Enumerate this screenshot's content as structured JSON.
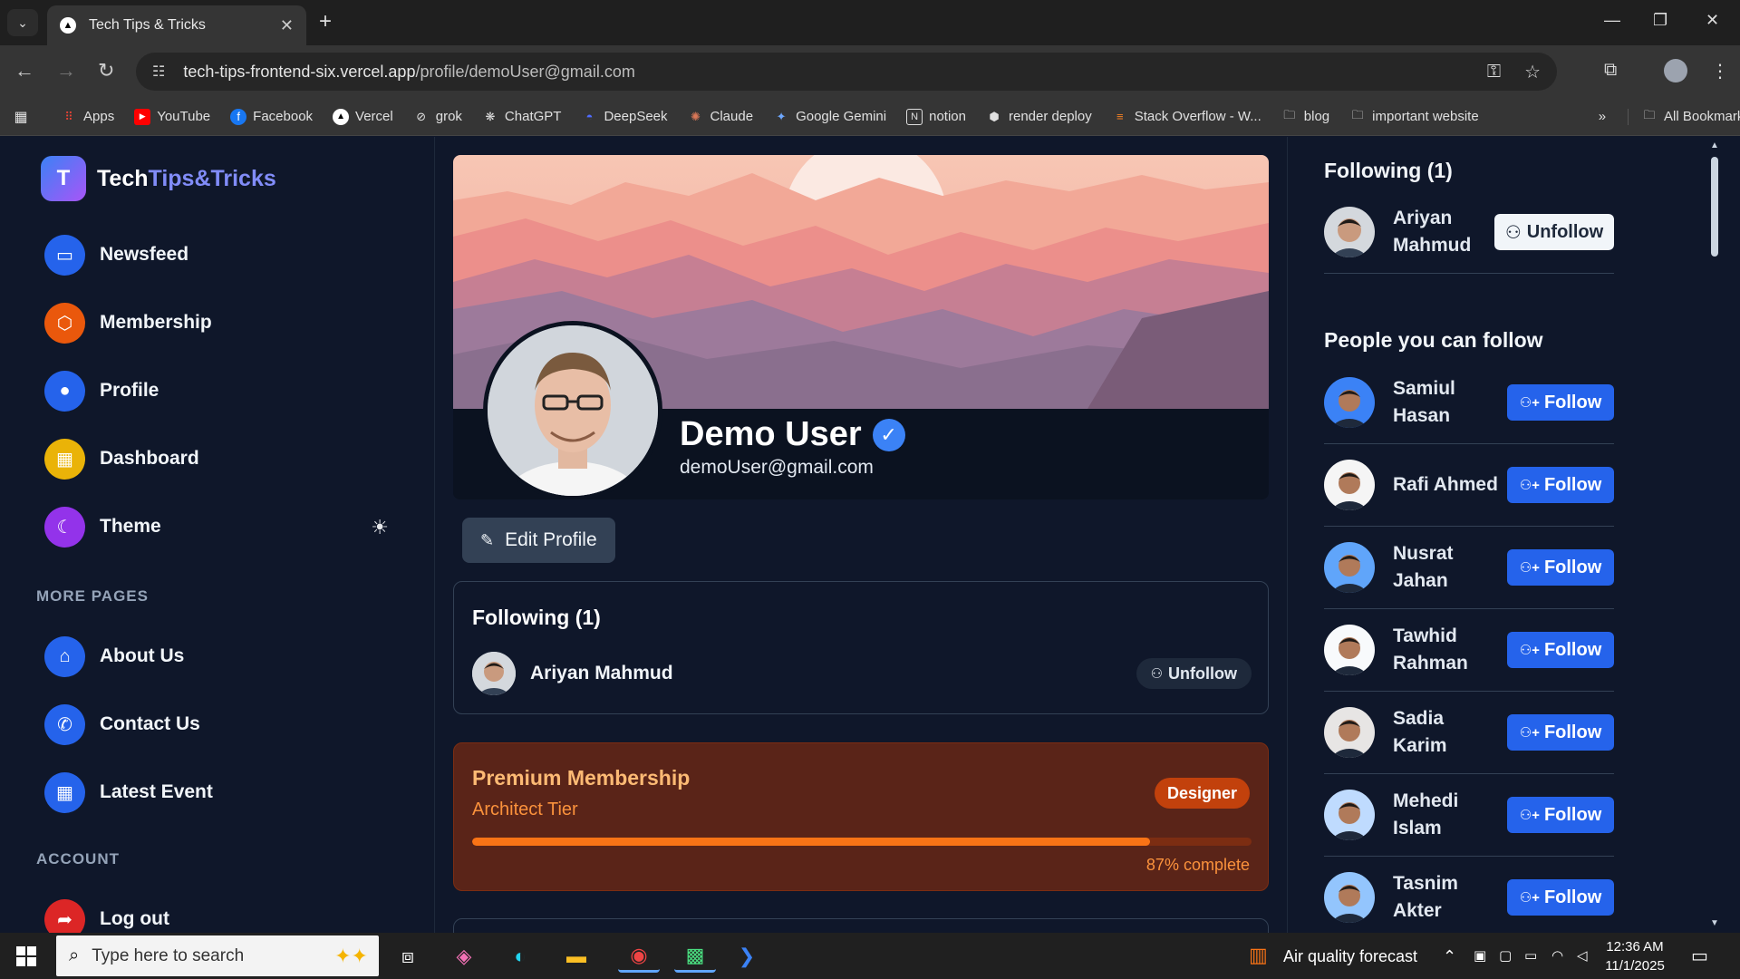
{
  "browser": {
    "tab_title": "Tech Tips & Tricks",
    "url_host": "tech-tips-frontend-six.vercel.app",
    "url_path": "/profile/demoUser@gmail.com",
    "bookmarks": [
      "Apps",
      "YouTube",
      "Facebook",
      "Vercel",
      "grok",
      "ChatGPT",
      "DeepSeek",
      "Claude",
      "Google Gemini",
      "notion",
      "render deploy",
      "Stack Overflow - W...",
      "blog",
      "important website"
    ],
    "all_bookmarks": "All Bookmarks"
  },
  "sidebar": {
    "logo_letter": "T",
    "logo_part1": "Tech",
    "logo_part2": "Tips&Tricks",
    "nav": [
      {
        "label": "Newsfeed",
        "color": "#2563eb",
        "icon": "monitor-icon"
      },
      {
        "label": "Membership",
        "color": "#ea580c",
        "icon": "box-icon"
      },
      {
        "label": "Profile",
        "color": "#2563eb",
        "icon": "user-circle-icon"
      },
      {
        "label": "Dashboard",
        "color": "#eab308",
        "icon": "grid-icon"
      },
      {
        "label": "Theme",
        "color": "#9333ea",
        "icon": "moon-icon"
      }
    ],
    "more_pages_heading": "MORE PAGES",
    "more_pages": [
      {
        "label": "About Us",
        "color": "#2563eb",
        "icon": "about-icon"
      },
      {
        "label": "Contact Us",
        "color": "#2563eb",
        "icon": "phone-icon"
      },
      {
        "label": "Latest Event",
        "color": "#2563eb",
        "icon": "calendar-icon"
      }
    ],
    "account_heading": "ACCOUNT",
    "account": [
      {
        "label": "Log out",
        "color": "#dc2626",
        "icon": "logout-icon"
      }
    ]
  },
  "profile": {
    "name": "Demo User",
    "email": "demoUser@gmail.com",
    "edit_label": "Edit Profile"
  },
  "following_card": {
    "heading": "Following (1)",
    "user": "Ariyan Mahmud",
    "unfollow_label": "Unfollow"
  },
  "premium": {
    "title": "Premium Membership",
    "tier": "Architect Tier",
    "badge": "Designer",
    "progress": 87,
    "progress_text": "87% complete"
  },
  "rightbar": {
    "following_heading": "Following (1)",
    "following": [
      {
        "first": "Ariyan",
        "last": "Mahmud",
        "action": "Unfollow"
      }
    ],
    "suggest_heading": "People you can follow",
    "suggest": [
      {
        "first": "Samiul",
        "last": "Hasan",
        "action": "Follow",
        "bg": "#3b82f6"
      },
      {
        "first": "Rafi Ahmed",
        "last": "",
        "action": "Follow",
        "bg": "#f5f5f5"
      },
      {
        "first": "Nusrat",
        "last": "Jahan",
        "action": "Follow",
        "bg": "#60a5fa"
      },
      {
        "first": "Tawhid",
        "last": "Rahman",
        "action": "Follow",
        "bg": "#f8fafc"
      },
      {
        "first": "Sadia",
        "last": "Karim",
        "action": "Follow",
        "bg": "#e7e5e4"
      },
      {
        "first": "Mehedi",
        "last": "Islam",
        "action": "Follow",
        "bg": "#bfdbfe"
      },
      {
        "first": "Tasnim",
        "last": "Akter",
        "action": "Follow",
        "bg": "#93c5fd"
      }
    ]
  },
  "taskbar": {
    "search_placeholder": "Type here to search",
    "weather": "Air quality forecast",
    "time": "12:36 AM",
    "date": "11/1/2025"
  }
}
